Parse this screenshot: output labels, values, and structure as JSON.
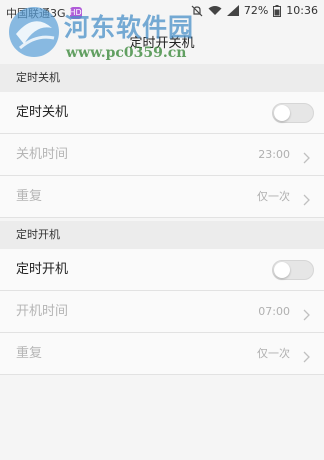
{
  "status_bar": {
    "carrier": "中国联通3G",
    "badge": "HD",
    "battery": "72%",
    "time": "10:36"
  },
  "watermark": {
    "title": "河东软件园",
    "url": "www.pc0359.cn"
  },
  "title": "定时开关机",
  "shutdown": {
    "header": "定时关机",
    "toggle_label": "定时关机",
    "toggle_on": false,
    "time_label": "关机时间",
    "time_value": "23:00",
    "repeat_label": "重复",
    "repeat_value": "仅一次"
  },
  "poweron": {
    "header": "定时开机",
    "toggle_label": "定时开机",
    "toggle_on": false,
    "time_label": "开机时间",
    "time_value": "07:00",
    "repeat_label": "重复",
    "repeat_value": "仅一次"
  },
  "icons": {
    "mute": "mute-icon",
    "wifi": "wifi-icon",
    "signal": "signal-icon",
    "chevron": "chevron-right-icon"
  }
}
